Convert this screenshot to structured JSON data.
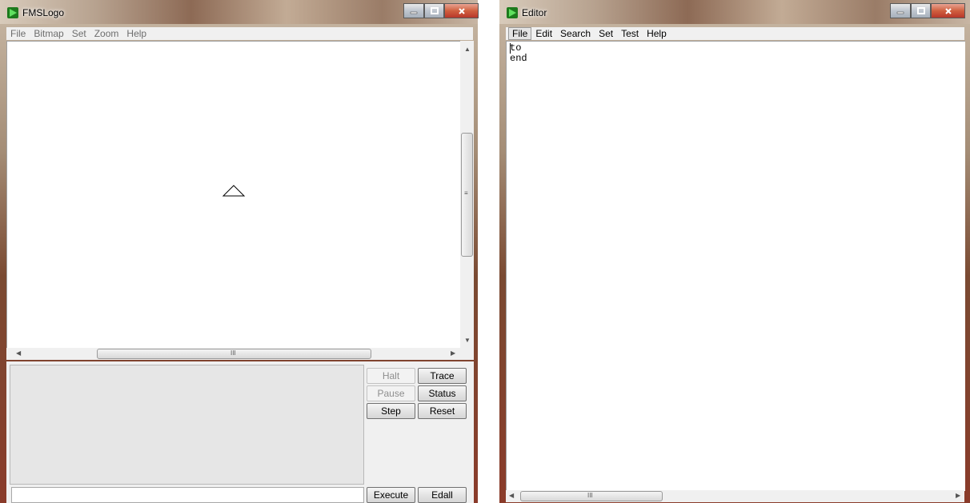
{
  "fmslogo": {
    "title": "FMSLogo",
    "menu": [
      "File",
      "Bitmap",
      "Set",
      "Zoom",
      "Help"
    ],
    "buttons": {
      "halt": "Halt",
      "trace": "Trace",
      "pause": "Pause",
      "status": "Status",
      "step": "Step",
      "reset": "Reset",
      "execute": "Execute",
      "edall": "Edall"
    },
    "command_input_value": "",
    "grip": "III"
  },
  "editor": {
    "title": "Editor",
    "menu": [
      "File",
      "Edit",
      "Search",
      "Set",
      "Test",
      "Help"
    ],
    "lines": [
      "to",
      "end"
    ],
    "grip": "III"
  },
  "colors": {
    "icon_green": "#2fb82f",
    "close_red": "#c8452c",
    "panel_gray": "#e6e6e6"
  }
}
